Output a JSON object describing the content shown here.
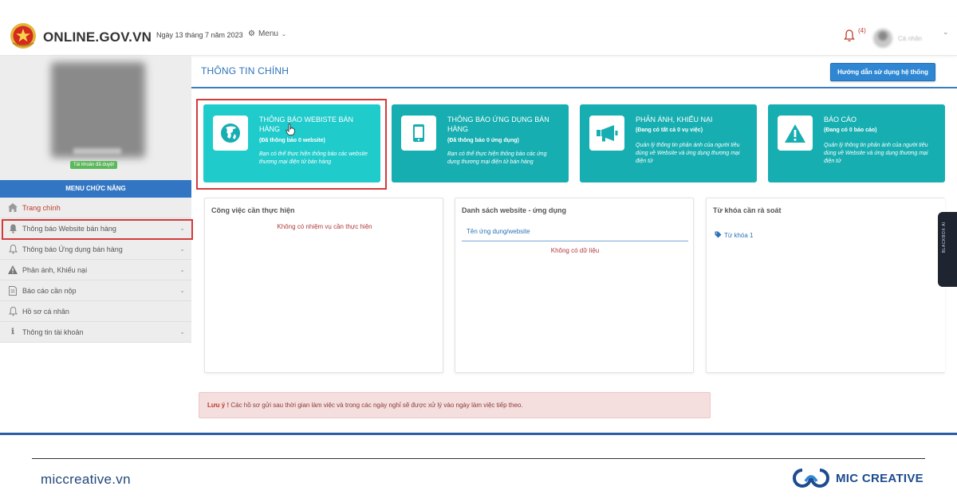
{
  "header": {
    "site_name": "ONLINE.GOV.VN",
    "date": "Ngày 13 tháng 7 năm 2023",
    "menu_label": "Menu",
    "notification_count": "(4)",
    "user_name": "Cá nhân"
  },
  "sidebar": {
    "account_status": "Tài khoản đã duyệt",
    "menu_heading": "MENU CHỨC NĂNG",
    "items": [
      {
        "label": "Trang chính"
      },
      {
        "label": "Thông báo Website bán hàng"
      },
      {
        "label": "Thông báo Ứng dụng bán hàng"
      },
      {
        "label": "Phản ánh, Khiếu nại"
      },
      {
        "label": "Báo cáo cần nộp"
      },
      {
        "label": "Hồ sơ cá nhân"
      },
      {
        "label": "Thông tin tài khoản"
      }
    ]
  },
  "main": {
    "title": "THÔNG TIN CHÍNH",
    "guide_button": "Hướng dẫn sử dụng hệ thống",
    "cards": [
      {
        "title": "THÔNG BÁO WEBISTE BÁN HÀNG",
        "subtitle": "(Đã thông báo 0 website)",
        "description": "Bạn có thể thực hiện thông báo các website thương mại điện tử bán hàng"
      },
      {
        "title": "THÔNG BÁO ỨNG DỤNG BÁN HÀNG",
        "subtitle": "(Đã thông báo 0 ứng dụng)",
        "description": "Bạn có thể thực hiện thông báo các ứng dụng thương mại điện tử bán hàng"
      },
      {
        "title": "PHẢN ÁNH, KHIẾU NẠI",
        "subtitle": "(Đang có tất cả 0 vụ việc)",
        "description": "Quản lý thông tin phản ánh của người tiêu dùng về Website và ứng dụng thương mại điện tử"
      },
      {
        "title": "BÁO CÁO",
        "subtitle": "(Đang có 0 báo cáo)",
        "description": "Quản lý thông tin phản ánh của người tiêu dùng về Website và ứng dụng thương mại điện tử"
      }
    ],
    "panels": {
      "tasks_title": "Công việc cần thực hiện",
      "tasks_empty": "Không có nhiệm vụ cần thực hiện",
      "list_title": "Danh sách website - ứng dụng",
      "list_column": "Tên ứng dụng/website",
      "list_empty": "Không có dữ liệu",
      "keywords_title": "Từ khóa cần rà soát",
      "keyword_link": "Từ khóa 1"
    },
    "notice_label": "Lưu ý !",
    "notice_text": "Các hồ sơ gửi sau thời gian làm việc và trong các ngày nghỉ sẽ được xử lý vào ngày làm việc tiếp theo."
  },
  "widget": {
    "label": "BLACKBOX AI"
  },
  "footer": {
    "site": "miccreative.vn",
    "brand": "MIC CREATIVE"
  },
  "colors": {
    "accent": "#2d72b8",
    "card": "#17aeb1",
    "card_active": "#20cbcc",
    "highlight": "#d33b3b",
    "notice_bg": "#f5dede"
  }
}
